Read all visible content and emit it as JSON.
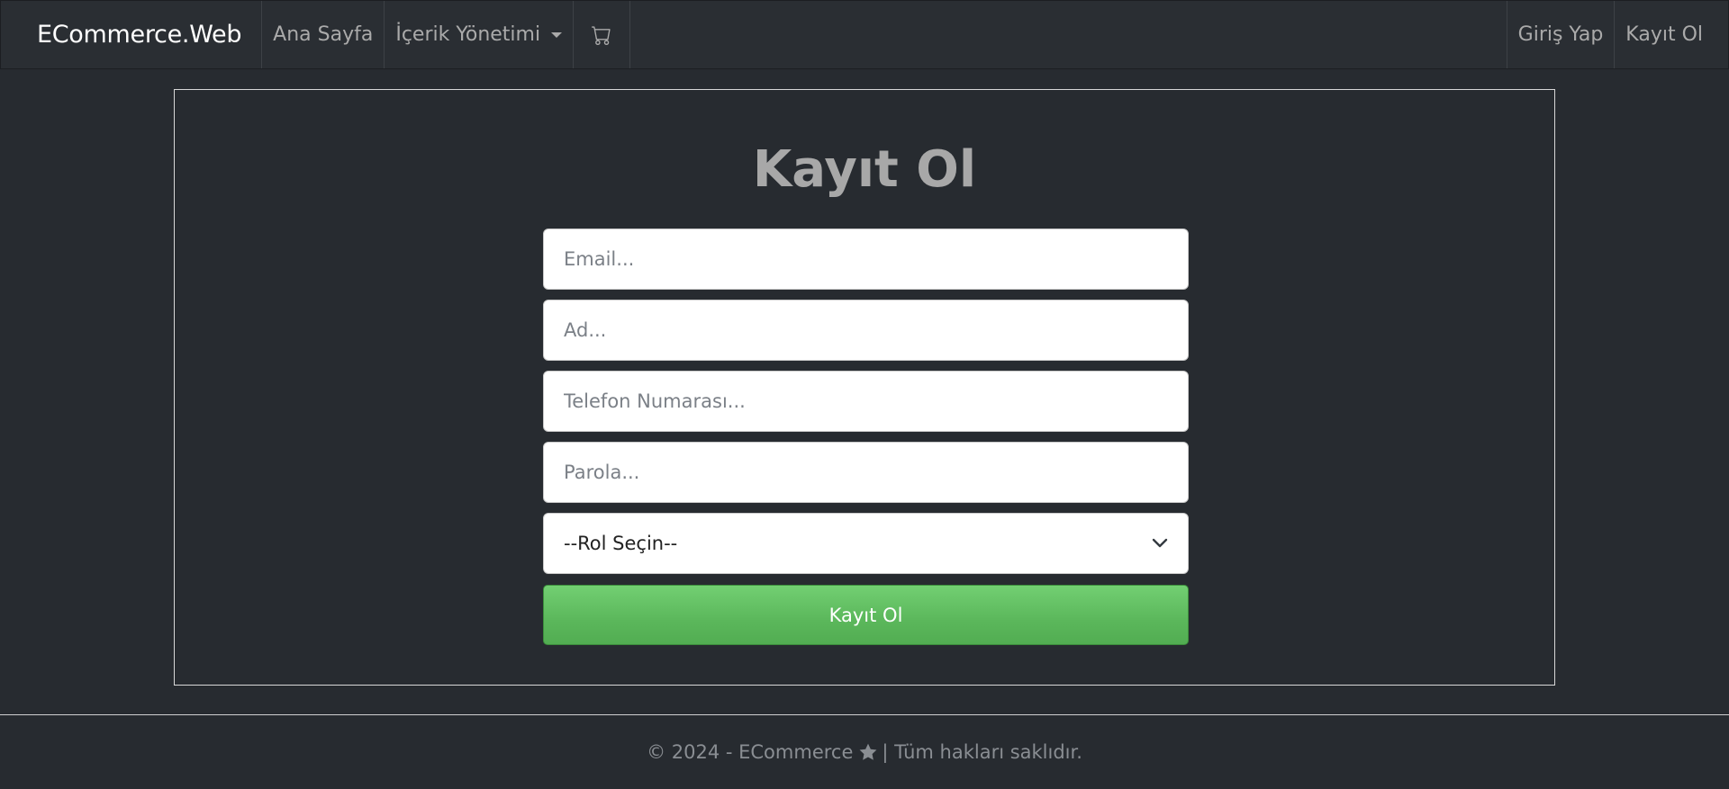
{
  "navbar": {
    "brand": "ECommerce.Web",
    "items": [
      {
        "label": "Ana Sayfa"
      },
      {
        "label": "İçerik Yönetimi"
      }
    ],
    "cart_icon": "cart-icon",
    "right_items": [
      {
        "label": "Giriş Yap"
      },
      {
        "label": "Kayıt Ol"
      }
    ]
  },
  "form": {
    "title": "Kayıt Ol",
    "email_placeholder": "Email...",
    "name_placeholder": "Ad...",
    "phone_placeholder": "Telefon Numarası...",
    "password_placeholder": "Parola...",
    "role_selected": "--Rol Seçin--",
    "submit_label": "Kayıt Ol"
  },
  "footer": {
    "prefix": "© 2024 - ECommerce",
    "suffix": "| Tüm hakları saklıdır.",
    "icon": "star-icon"
  },
  "colors": {
    "background": "#272b30",
    "submit": "#62c462",
    "text_muted": "#aaaaaa"
  }
}
